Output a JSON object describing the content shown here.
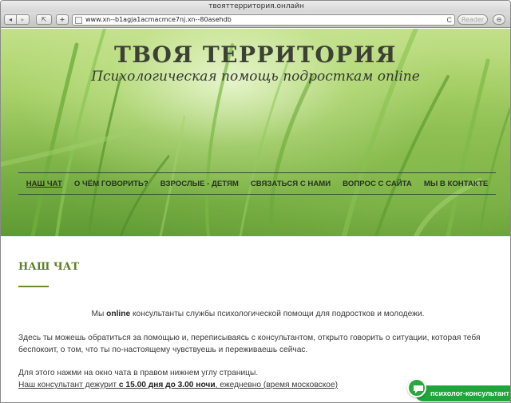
{
  "browser": {
    "window_title": "твояттерритория.онлайн",
    "url": "www.xn--b1agja1acmacmce7nj.xn--80asehdb",
    "back_symbol": "◂",
    "forward_symbol": "▸",
    "share_symbol": "⇱",
    "add_symbol": "+",
    "reload_symbol": "C",
    "reader_label": "Reader",
    "downloads_symbol": "⊖"
  },
  "site": {
    "title": "ТВОЯ ТЕРРИТОРИЯ",
    "subtitle": "Психологическая помощь подросткам online"
  },
  "nav": {
    "items": [
      {
        "label": "НАШ ЧАТ"
      },
      {
        "label": "О ЧЁМ ГОВОРИТЬ?"
      },
      {
        "label": "ВЗРОСЛЫЕ - ДЕТЯМ"
      },
      {
        "label": "СВЯЗАТЬСЯ С НАМИ"
      },
      {
        "label": "ВОПРОС С САЙТА"
      },
      {
        "label": "МЫ В КОНТАКТЕ"
      }
    ]
  },
  "content": {
    "heading": "НАШ ЧАТ",
    "p1_pre": "Мы ",
    "p1_bold": "online",
    "p1_post": " консультанты службы психологической помощи для подростков и молодежи.",
    "p2": "Здесь ты можешь обратиться за помощью и, переписываясь с консультантом, открыто говорить о ситуации, которая тебя беспокоит, о том, что ты по-настоящему чувствуешь и переживаешь сейчас.",
    "p3": "Для этого нажми на окно чата в правом нижнем углу страницы.",
    "p4_pre": "Наш консультант дежурит ",
    "p4_bold": "с 15.00 дня до 3.00 ночи",
    "p4_post": ", ежедневно (время московское)"
  },
  "chat_widget": {
    "label": "психолог-консультант"
  },
  "colors": {
    "accent_green": "#5f7f26",
    "chat_green": "#1ea63a",
    "nav_text": "#253320"
  }
}
